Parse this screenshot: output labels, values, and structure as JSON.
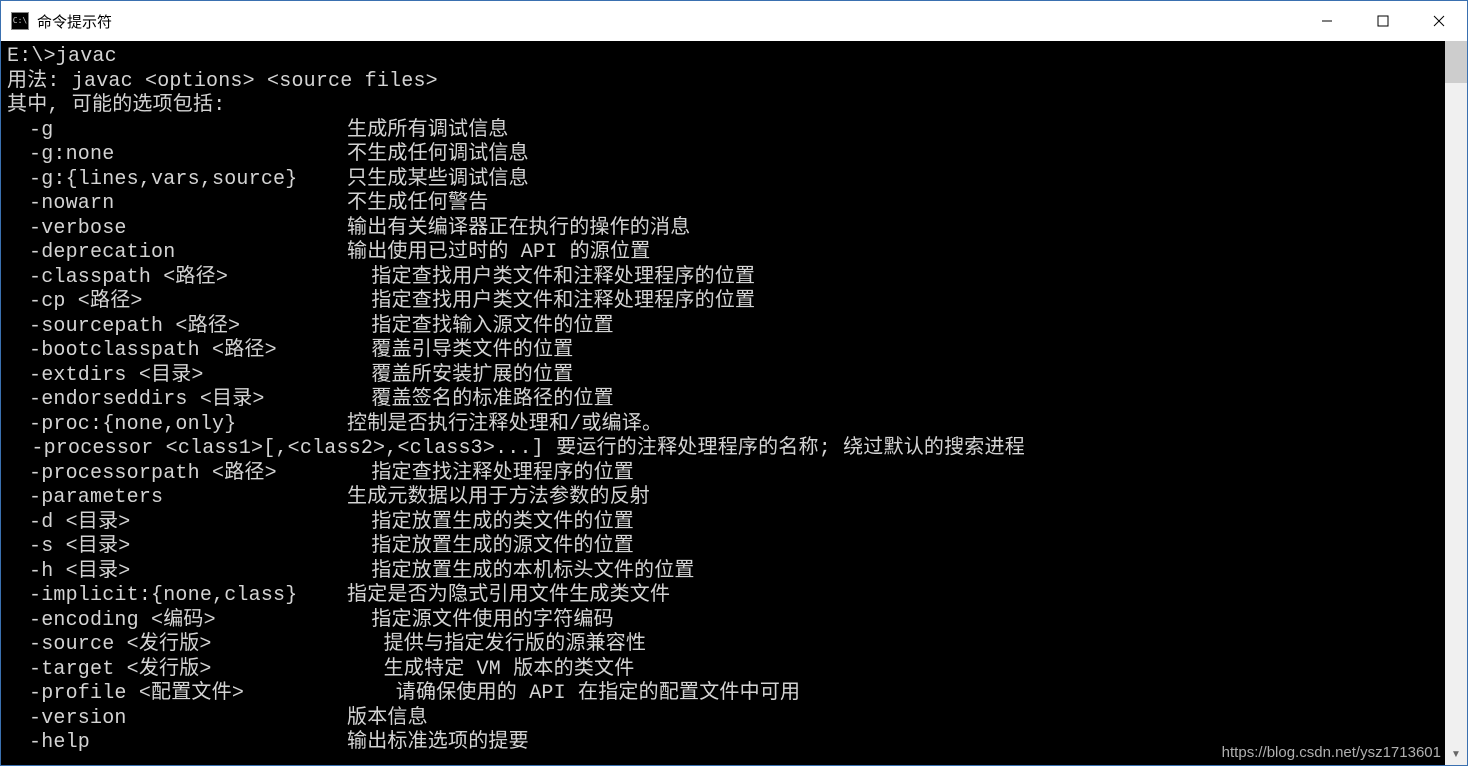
{
  "window": {
    "title": "命令提示符",
    "icon_label": "C:\\"
  },
  "watermark": "https://blog.csdn.net/ysz1713601",
  "terminal": {
    "prompt": "E:\\>javac",
    "usage": "用法: javac <options> <source files>",
    "options_intro": "其中, 可能的选项包括:",
    "options": [
      {
        "flag": "-g",
        "desc": "生成所有调试信息"
      },
      {
        "flag": "-g:none",
        "desc": "不生成任何调试信息"
      },
      {
        "flag": "-g:{lines,vars,source}",
        "desc": "只生成某些调试信息"
      },
      {
        "flag": "-nowarn",
        "desc": "不生成任何警告"
      },
      {
        "flag": "-verbose",
        "desc": "输出有关编译器正在执行的操作的消息"
      },
      {
        "flag": "-deprecation",
        "desc": "输出使用已过时的 API 的源位置"
      },
      {
        "flag": "-classpath <路径>",
        "desc": "  指定查找用户类文件和注释处理程序的位置"
      },
      {
        "flag": "-cp <路径>",
        "desc": "  指定查找用户类文件和注释处理程序的位置"
      },
      {
        "flag": "-sourcepath <路径>",
        "desc": "  指定查找输入源文件的位置"
      },
      {
        "flag": "-bootclasspath <路径>",
        "desc": "  覆盖引导类文件的位置"
      },
      {
        "flag": "-extdirs <目录>",
        "desc": "  覆盖所安装扩展的位置"
      },
      {
        "flag": "-endorseddirs <目录>",
        "desc": "  覆盖签名的标准路径的位置"
      },
      {
        "flag": "-proc:{none,only}",
        "desc": "控制是否执行注释处理和/或编译。"
      },
      {
        "flag": "",
        "desc": "",
        "full": "  -processor <class1>[,<class2>,<class3>...] 要运行的注释处理程序的名称; 绕过默认的搜索进程"
      },
      {
        "flag": "-processorpath <路径>",
        "desc": "  指定查找注释处理程序的位置"
      },
      {
        "flag": "-parameters",
        "desc": "生成元数据以用于方法参数的反射"
      },
      {
        "flag": "-d <目录>",
        "desc": "  指定放置生成的类文件的位置"
      },
      {
        "flag": "-s <目录>",
        "desc": "  指定放置生成的源文件的位置"
      },
      {
        "flag": "-h <目录>",
        "desc": "  指定放置生成的本机标头文件的位置"
      },
      {
        "flag": "-implicit:{none,class}",
        "desc": "指定是否为隐式引用文件生成类文件"
      },
      {
        "flag": "-encoding <编码>",
        "desc": "  指定源文件使用的字符编码"
      },
      {
        "flag": "-source <发行版>",
        "desc": "   提供与指定发行版的源兼容性"
      },
      {
        "flag": "-target <发行版>",
        "desc": "   生成特定 VM 版本的类文件"
      },
      {
        "flag": "-profile <配置文件>",
        "desc": "    请确保使用的 API 在指定的配置文件中可用"
      },
      {
        "flag": "-version",
        "desc": "版本信息"
      },
      {
        "flag": "-help",
        "desc": "输出标准选项的提要"
      }
    ]
  }
}
